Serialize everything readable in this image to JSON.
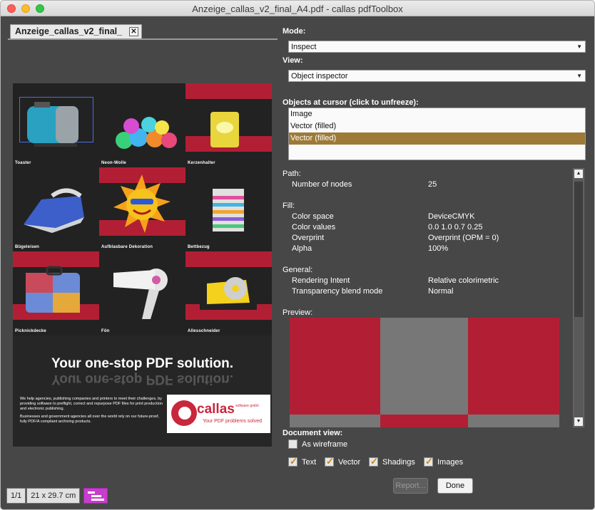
{
  "window": {
    "title": "Anzeige_callas_v2_final_A4.pdf - callas pdfToolbox"
  },
  "document_tab": {
    "label": "Anzeige_callas_v2_final_",
    "close_glyph": "✕"
  },
  "ad": {
    "cells": [
      {
        "label": "Toaster"
      },
      {
        "label": "Neon-Wolle"
      },
      {
        "label": "Kerzenhalter"
      },
      {
        "label": "Bügeleisen"
      },
      {
        "label": "Aufblasbare Dekoration"
      },
      {
        "label": "Bettbezug"
      },
      {
        "label": "Picknickdecke"
      },
      {
        "label": "Fön"
      },
      {
        "label": "Allesschneider"
      }
    ],
    "headline": "Your one-stop PDF solution.",
    "body_1": "We help agencies, publishing companies and printers to meet their challenges, by providing software to preflight, correct and repurpose PDF files for print production and electronic publishing.",
    "body_2": "Businesses and government agencies all over the world rely on our future-proof, fully PDF/A compliant archiving products.",
    "logo": {
      "name": "callas",
      "sub": "software gmbh",
      "tagline": "Your PDF problems solved"
    }
  },
  "statusbar": {
    "page": "1/1",
    "size": "21 x 29.7 cm"
  },
  "inspector": {
    "mode_label": "Mode:",
    "mode_value": "Inspect",
    "view_label": "View:",
    "view_value": "Object inspector",
    "objects_label": "Objects at cursor (click to unfreeze):",
    "objects": [
      "Image",
      "Vector (filled)",
      "Vector (filled)"
    ],
    "selected_object_index": 2,
    "path_heading": "Path:",
    "nodes_label": "Number of nodes",
    "nodes_value": "25",
    "fill_heading": "Fill:",
    "color_space_label": "Color space",
    "color_space_value": "DeviceCMYK",
    "color_values_label": "Color values",
    "color_values_value": "0.0  1.0  0.7  0.25",
    "overprint_label": "Overprint",
    "overprint_value": "Overprint (OPM = 0)",
    "alpha_label": "Alpha",
    "alpha_value": "100%",
    "general_heading": "General:",
    "rendering_label": "Rendering Intent",
    "rendering_value": "Relative colorimetric",
    "blend_label": "Transparency blend mode",
    "blend_value": "Normal",
    "preview_label": "Preview:",
    "docview_label": "Document view:",
    "wireframe_label": "As wireframe",
    "wireframe_checked": false,
    "text_label": "Text",
    "vector_label": "Vector",
    "shadings_label": "Shadings",
    "images_label": "Images",
    "report_button": "Report...",
    "done_button": "Done"
  },
  "colors": {
    "accent_red": "#b21f34",
    "selection_brown": "#9d7a37",
    "preview_gray": "#777777"
  }
}
